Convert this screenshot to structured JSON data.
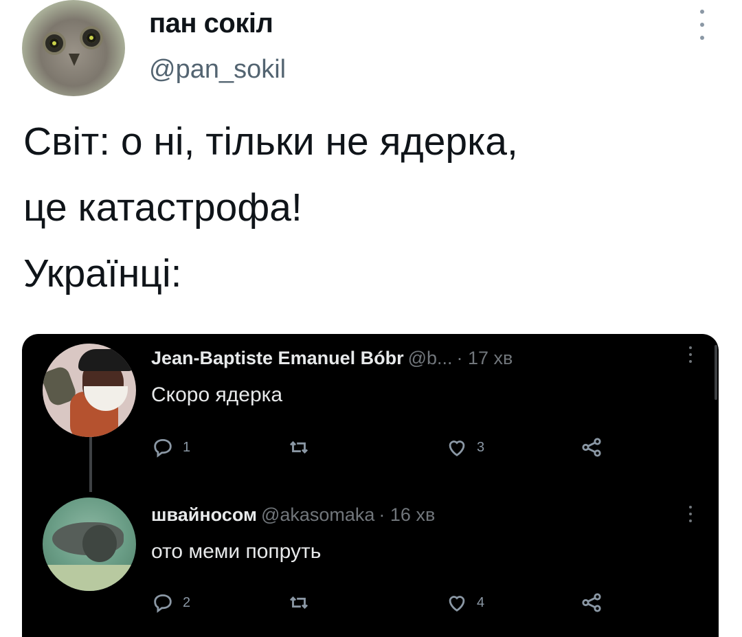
{
  "tweet": {
    "author_name": "пан сокіл",
    "author_handle": "@pan_sokil",
    "text_lines": [
      "Світ: о ні, тільки не ядерка,",
      "це катастрофа!",
      "Українці:"
    ]
  },
  "embedded_thread": {
    "background": "#000000",
    "replies": [
      {
        "name": "Jean-Baptiste Emanuel Bóbr",
        "handle": "@b...",
        "time": "· 17 хв",
        "text": "Скоро ядерка",
        "reply_count": "1",
        "like_count": "3",
        "avatar_icon": "beaver-cartoon-avatar"
      },
      {
        "name": "швайносом",
        "handle": "@akasomaka",
        "time": "· 16 хв",
        "text": "ото меми попруть",
        "reply_count": "2",
        "like_count": "4",
        "avatar_icon": "catfish-photo-avatar"
      }
    ]
  },
  "icons": {
    "reply": "reply-icon",
    "retweet": "retweet-icon",
    "like": "heart-icon",
    "share": "share-icon",
    "more": "more-vertical-icon"
  }
}
